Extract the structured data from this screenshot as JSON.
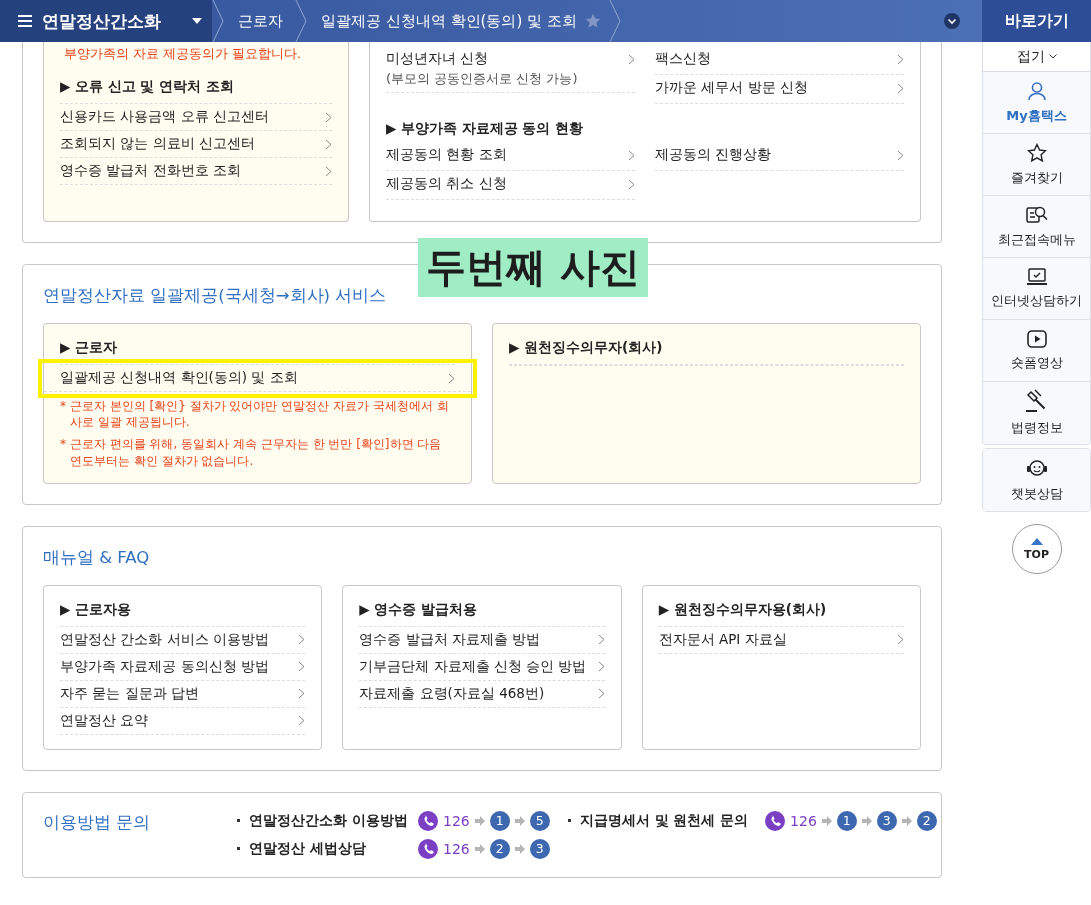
{
  "header": {
    "title": "연말정산간소화",
    "breadcrumbs": [
      "근로자",
      "일괄제공 신청내역 확인(동의) 및 조회"
    ],
    "favorite": false
  },
  "top_section": {
    "left_card": {
      "notice": "부양가족의 자료 제공동의가 필요합니다.",
      "heading": "▶ 오류 신고 및 연락처 조회",
      "links": [
        "신용카드 사용금액 오류 신고센터",
        "조회되지 않는 의료비 신고센터",
        "영수증 발급처 전화번호 조회"
      ]
    },
    "right_card": {
      "groups": [
        {
          "columns": [
            [
              {
                "label": "미성년자녀 신청",
                "note": "(부모의 공동인증서로 신청 가능)"
              }
            ],
            [
              {
                "label": "팩스신청"
              },
              {
                "label": "가까운 세무서 방문 신청"
              }
            ]
          ]
        },
        {
          "heading": "▶ 부양가족 자료제공 동의 현황",
          "columns": [
            [
              {
                "label": "제공동의 현황 조회"
              },
              {
                "label": "제공동의 취소 신청"
              }
            ],
            [
              {
                "label": "제공동의 진행상황"
              }
            ]
          ]
        }
      ]
    }
  },
  "service": {
    "title": "연말정산자료 일괄제공(국세청→회사) 서비스",
    "annotation": "두번째 사진",
    "cards": [
      {
        "heading": "▶ 근로자",
        "links": [
          {
            "label": "일괄제공 신청내역 확인(동의) 및 조회",
            "highlighted": true
          }
        ],
        "notes": [
          "* 근로자 본인의 [확인} 절차가 있어야만 연말정산 자료가 국세청에서 회사로 일괄 제공됩니다.",
          "* 근로자 편의를 위해, 동일회사 계속 근무자는 한 번만 [확인]하면 다음 연도부터는 확인 절차가 없습니다."
        ]
      },
      {
        "heading": "▶ 원천징수의무자(회사)"
      }
    ]
  },
  "manual": {
    "title": "매뉴얼 & FAQ",
    "cards": [
      {
        "heading": "▶ 근로자용",
        "links": [
          "연말정산 간소화 서비스 이용방법",
          "부양가족 자료제공 동의신청 방법",
          "자주 묻는 질문과 답변",
          "연말정산 요약"
        ]
      },
      {
        "heading": "▶ 영수증 발급처용",
        "links": [
          "영수증 발급처 자료제출 방법",
          "기부금단체 자료제출 신청 승인 방법",
          "자료제출 요령(자료실 468번)"
        ]
      },
      {
        "heading": "▶ 원천징수의무자용(회사)",
        "links": [
          "전자문서 API 자료실"
        ]
      }
    ]
  },
  "contact": {
    "title": "이용방법 문의",
    "lines": [
      {
        "label": "연말정산간소화 이용방법",
        "phone": "126",
        "steps": [
          "1",
          "5"
        ]
      },
      {
        "label": "지급명세서 및 원천세 문의",
        "phone": "126",
        "steps": [
          "1",
          "3",
          "2"
        ]
      },
      {
        "label": "연말정산 세법상담",
        "phone": "126",
        "steps": [
          "2",
          "3"
        ]
      }
    ]
  },
  "quick_menu": {
    "title": "바로가기",
    "collapse": "접기",
    "groups": [
      [
        {
          "label": "My홈택스",
          "selected": true
        },
        {
          "label": "즐겨찾기",
          "selected": false
        },
        {
          "label": "최근접속메뉴",
          "selected": false
        },
        {
          "label": "인터넷상담하기",
          "selected": false
        },
        {
          "label": "숏폼영상",
          "selected": false
        },
        {
          "label": "법령정보",
          "selected": false
        }
      ],
      [
        {
          "label": "챗봇상담",
          "selected": false
        }
      ]
    ],
    "top": "TOP"
  }
}
